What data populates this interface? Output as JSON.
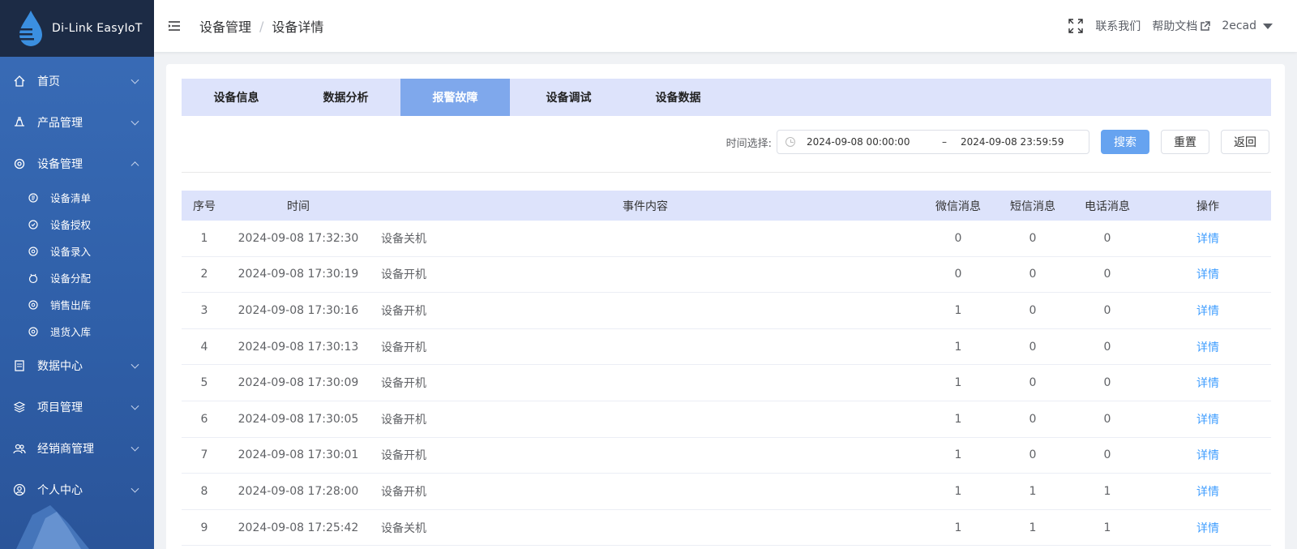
{
  "app": {
    "logo_text": "Di-Link EasyIoT"
  },
  "sidebar": {
    "items": [
      {
        "label": "首页",
        "icon": "home-icon",
        "expanded": false
      },
      {
        "label": "产品管理",
        "icon": "product-icon",
        "expanded": false
      },
      {
        "label": "设备管理",
        "icon": "device-icon",
        "expanded": true,
        "children": [
          {
            "label": "设备清单",
            "icon": "list-icon"
          },
          {
            "label": "设备授权",
            "icon": "auth-icon"
          },
          {
            "label": "设备录入",
            "icon": "entry-icon"
          },
          {
            "label": "设备分配",
            "icon": "assign-icon"
          },
          {
            "label": "销售出库",
            "icon": "outbound-icon"
          },
          {
            "label": "退货入库",
            "icon": "return-icon"
          }
        ]
      },
      {
        "label": "数据中心",
        "icon": "data-icon",
        "expanded": false
      },
      {
        "label": "项目管理",
        "icon": "project-icon",
        "expanded": false
      },
      {
        "label": "经销商管理",
        "icon": "dealer-icon",
        "expanded": false
      },
      {
        "label": "个人中心",
        "icon": "user-icon",
        "expanded": false
      }
    ]
  },
  "header": {
    "breadcrumb": [
      "设备管理",
      "设备详情"
    ],
    "breadcrumb_sep": "/",
    "contact": "联系我们",
    "help": "帮助文档",
    "user": "2ecad"
  },
  "tabs": [
    {
      "label": "设备信息",
      "active": false
    },
    {
      "label": "数据分析",
      "active": false
    },
    {
      "label": "报警故障",
      "active": true
    },
    {
      "label": "设备调试",
      "active": false
    },
    {
      "label": "设备数据",
      "active": false
    }
  ],
  "filter": {
    "label": "时间选择:",
    "start": "2024-09-08 00:00:00",
    "separator": "–",
    "end": "2024-09-08 23:59:59",
    "search": "搜索",
    "reset": "重置",
    "back": "返回"
  },
  "table": {
    "columns": [
      "序号",
      "时间",
      "事件内容",
      "微信消息",
      "短信消息",
      "电话消息",
      "操作"
    ],
    "rows": [
      {
        "no": "1",
        "time": "2024-09-08 17:32:30",
        "event": "设备关机",
        "wx": "0",
        "sms": "0",
        "tel": "0",
        "op": "详情"
      },
      {
        "no": "2",
        "time": "2024-09-08 17:30:19",
        "event": "设备开机",
        "wx": "0",
        "sms": "0",
        "tel": "0",
        "op": "详情"
      },
      {
        "no": "3",
        "time": "2024-09-08 17:30:16",
        "event": "设备开机",
        "wx": "1",
        "sms": "0",
        "tel": "0",
        "op": "详情"
      },
      {
        "no": "4",
        "time": "2024-09-08 17:30:13",
        "event": "设备开机",
        "wx": "1",
        "sms": "0",
        "tel": "0",
        "op": "详情"
      },
      {
        "no": "5",
        "time": "2024-09-08 17:30:09",
        "event": "设备开机",
        "wx": "1",
        "sms": "0",
        "tel": "0",
        "op": "详情"
      },
      {
        "no": "6",
        "time": "2024-09-08 17:30:05",
        "event": "设备开机",
        "wx": "1",
        "sms": "0",
        "tel": "0",
        "op": "详情"
      },
      {
        "no": "7",
        "time": "2024-09-08 17:30:01",
        "event": "设备开机",
        "wx": "1",
        "sms": "0",
        "tel": "0",
        "op": "详情"
      },
      {
        "no": "8",
        "time": "2024-09-08 17:28:00",
        "event": "设备开机",
        "wx": "1",
        "sms": "1",
        "tel": "1",
        "op": "详情"
      },
      {
        "no": "9",
        "time": "2024-09-08 17:25:42",
        "event": "设备关机",
        "wx": "1",
        "sms": "1",
        "tel": "1",
        "op": "详情"
      }
    ]
  },
  "colors": {
    "sidebar": "#3a6db8",
    "logo_bar": "#1c2b45",
    "accent": "#7fa8ec",
    "primary_button": "#66a3f0",
    "link": "#409eff",
    "header_bg": "#dde3fb"
  }
}
